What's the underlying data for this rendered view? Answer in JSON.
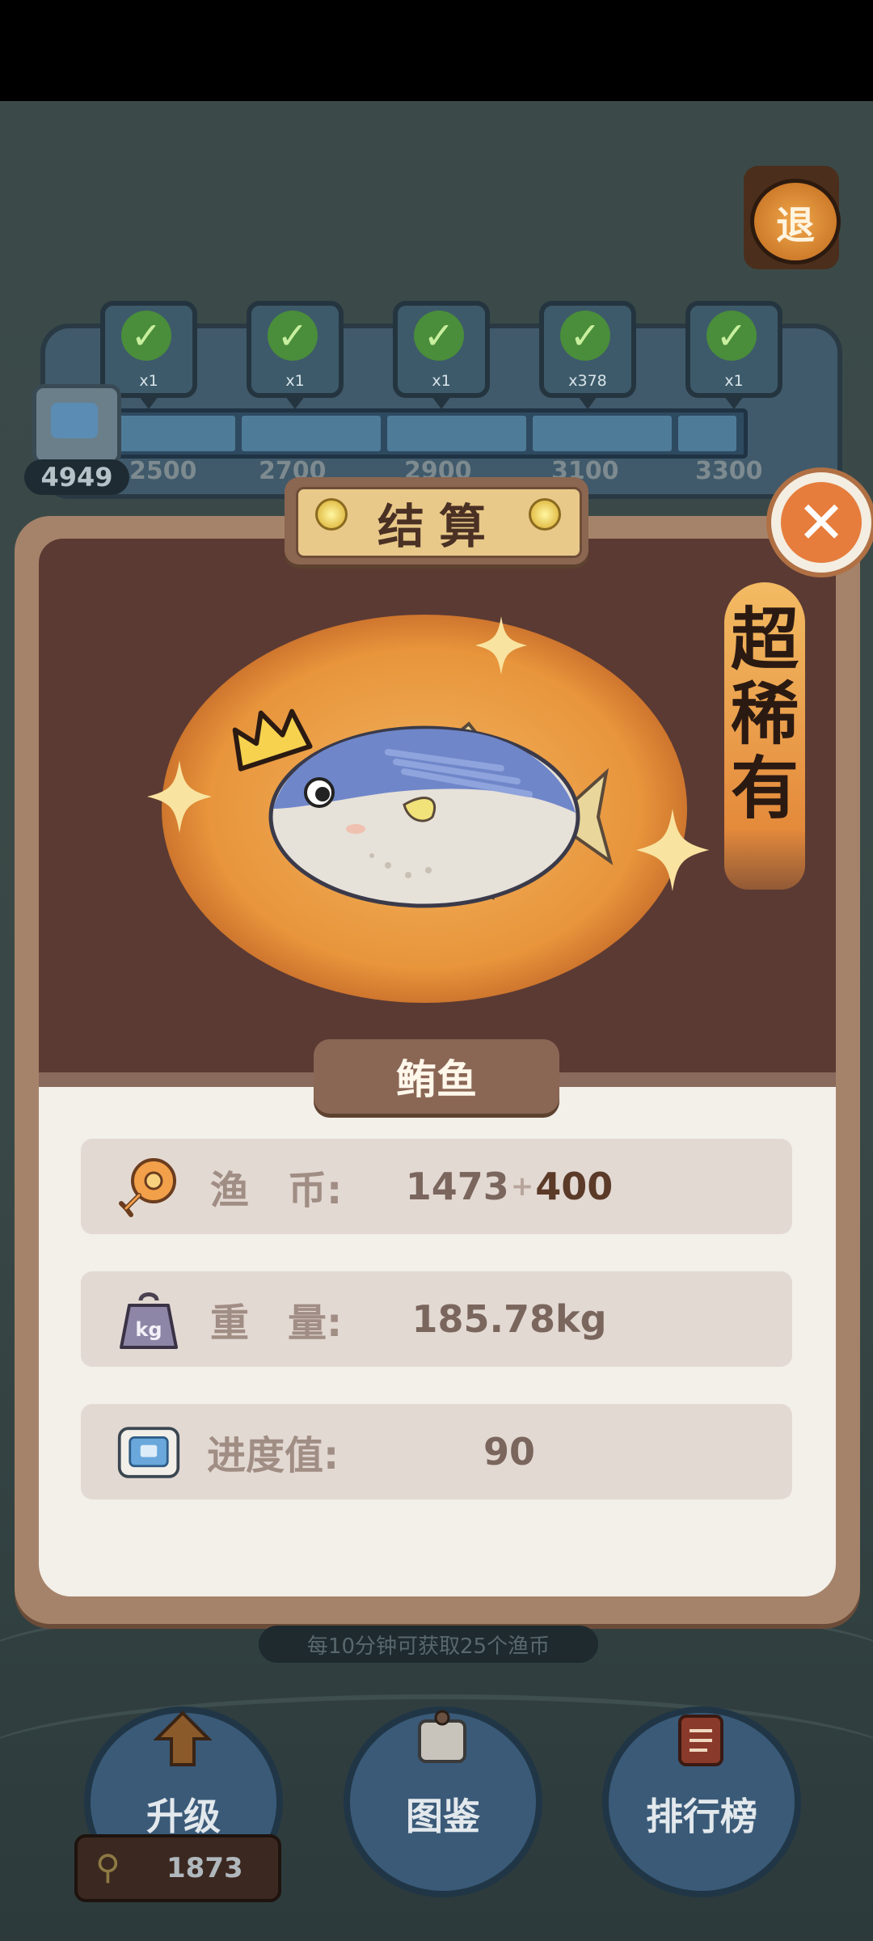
{
  "exit_button": {
    "label": "退"
  },
  "reward_track": {
    "current_progress": "4949",
    "slots": [
      {
        "qty": "x1",
        "claimed": true
      },
      {
        "qty": "x1",
        "claimed": true
      },
      {
        "qty": "x1",
        "claimed": true
      },
      {
        "qty": "x378",
        "claimed": true
      },
      {
        "qty": "x1",
        "claimed": true
      }
    ],
    "milestones": [
      "2500",
      "2700",
      "2900",
      "3100",
      "3300"
    ]
  },
  "result_modal": {
    "title": "结算",
    "rarity": "超稀有",
    "fish_name": "鲔鱼",
    "stats": {
      "coins": {
        "label": "渔　币:",
        "value": "1473",
        "plus": "+",
        "bonus": "400",
        "icon": "fish-coin-icon"
      },
      "weight": {
        "label": "重　量:",
        "value": "185.78kg",
        "icon": "kg-weight-icon"
      },
      "progress": {
        "label": "进度值:",
        "value": "90",
        "icon": "progress-ticket-icon"
      }
    }
  },
  "tip": "每10分钟可获取25个渔币",
  "hud": {
    "upgrade_label": "升级",
    "encyclopedia_label": "图鉴",
    "leaderboard_label": "排行榜",
    "coin_balance": "1873"
  },
  "colors": {
    "modal_frame": "#a5836a",
    "modal_dark": "#5b3a33",
    "glow": "#e8953c",
    "close": "#e67d3d",
    "panel": "#f3efe9"
  }
}
